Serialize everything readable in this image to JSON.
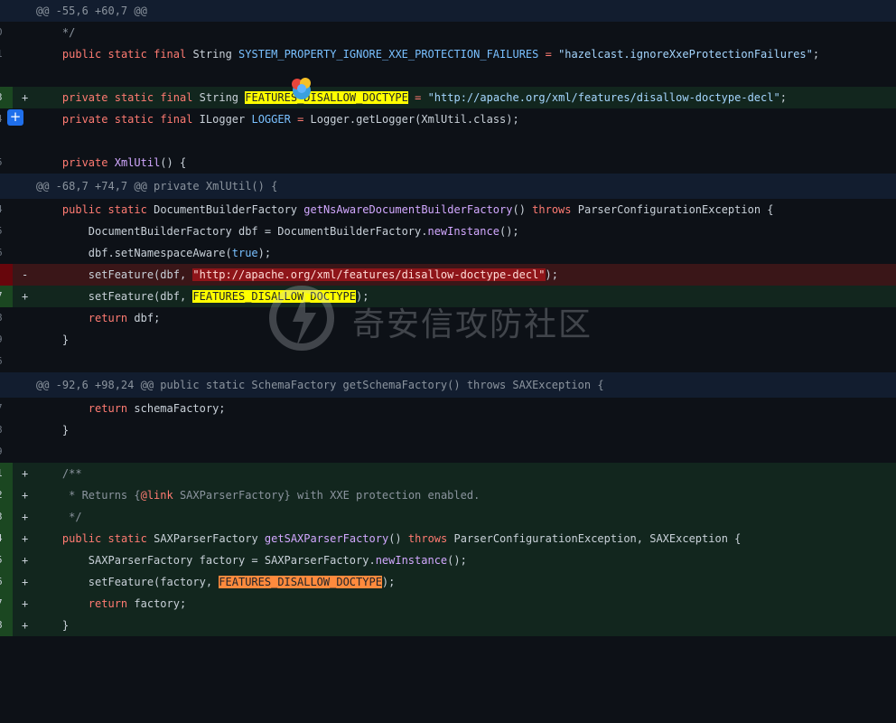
{
  "hunks": {
    "h1": "@@ -55,6 +60,7 @@",
    "h2": "@@ -68,7 +74,7 @@ private XmlUtil() {",
    "h3": "@@ -92,6 +98,24 @@ public static SchemaFactory getSchemaFactory() throws SAXException {"
  },
  "gutter": {
    "l1": "0",
    "l2": "1",
    "l3": "",
    "l4": "3",
    "l5": "4",
    "l6": "",
    "l7": "5",
    "l8": "4",
    "l9": "5",
    "l10": "6",
    "l11": "",
    "l12": "7",
    "l13": "8",
    "l14": "9",
    "l15": "6",
    "l16": "7",
    "l17": "8",
    "l18": "9",
    "l19": "1",
    "l20": "2",
    "l21": "3",
    "l22": "4",
    "l23": "5",
    "l24": "6",
    "l25": "7",
    "l26": "8"
  },
  "markers": {
    "plus": "+",
    "minus": "-"
  },
  "tokens": {
    "comment_end": "*/",
    "public": "public",
    "private": "private",
    "static": "static",
    "final": "final",
    "string_type": "String",
    "ilogger_type": "ILogger",
    "return": "return",
    "throws": "throws",
    "true": "true",
    "sys_prop_name": "SYSTEM_PROPERTY_IGNORE_XXE_PROTECTION_FAILURES",
    "sys_prop_value": "\"hazelcast.ignoreXxeProtectionFailures\"",
    "features_const": "FEATURES_DISALLOW_DOCTYPE",
    "features_value": "\"http://apache.org/xml/features/disallow-doctype-decl\"",
    "logger_name": "LOGGER",
    "logger_call": "Logger.getLogger(XmlUtil.class);",
    "xmlutil_ctor": "XmlUtil",
    "ctor_tail": "() {",
    "dbf_type": "DocumentBuilderFactory",
    "get_ns_method": "getNsAwareDocumentBuilderFactory",
    "parser_ex": "ParserConfigurationException {",
    "dbf_decl": "DocumentBuilderFactory dbf = DocumentBuilderFactory.",
    "new_instance": "newInstance",
    "call_end": "();",
    "ns_aware": "dbf.setNamespaceAware(",
    "paren_end": ");",
    "set_feature_dbf": "setFeature(dbf, ",
    "return_dbf": "dbf;",
    "close_brace": "}",
    "return_schema": "schemaFactory;",
    "javadoc_start": "/**",
    "javadoc_returns": " * Returns {",
    "javadoc_link": "@link",
    "javadoc_rest": " SAXParserFactory} with XXE protection enabled.",
    "javadoc_end": " */",
    "sax_type": "SAXParserFactory",
    "get_sax_method": "getSAXParserFactory",
    "sax_throws_tail": "ParserConfigurationException, SAXException {",
    "sax_decl": "SAXParserFactory factory = SAXParserFactory.",
    "set_feature_factory": "setFeature(factory, ",
    "return_factory": "factory;",
    "eq": " = ",
    "semi": ";",
    "parens": "()",
    "sp": " "
  },
  "buttons": {
    "add_comment": "+"
  },
  "watermark": {
    "text": "奇安信攻防社区"
  },
  "colors": {
    "add_bg": "#12261e",
    "del_bg": "#3a1618",
    "hunk_bg": "#121d2f",
    "highlight_yellow": "#ffff00",
    "highlight_orange": "#ff8a3d",
    "accent_blue": "#1f6feb"
  }
}
